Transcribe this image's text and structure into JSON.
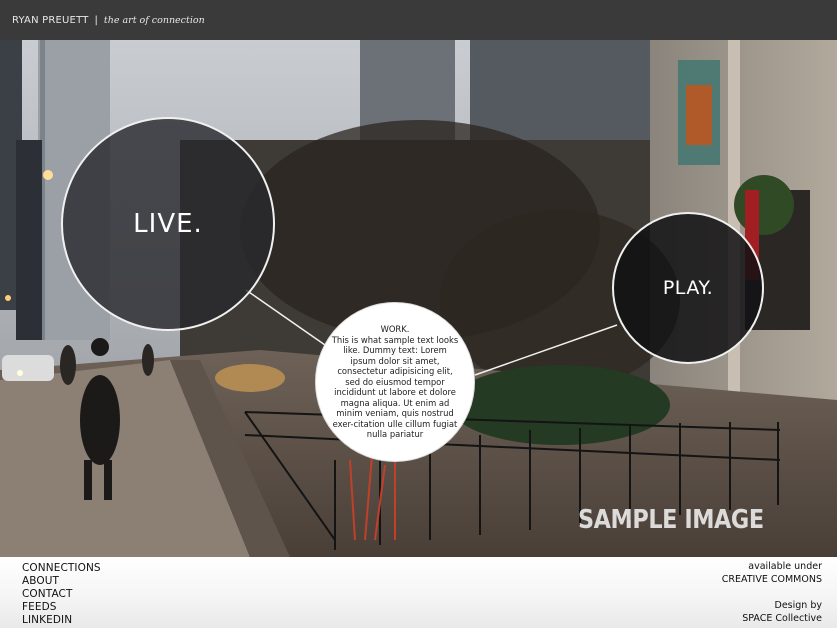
{
  "header": {
    "name": "RYAN PREUETT",
    "separator": "|",
    "tagline": "the art of connection"
  },
  "circles": {
    "live": "LIVE.",
    "play": "PLAY.",
    "work_title": "WORK.",
    "work_body": "This is what sample text looks like. Dummy text: Lorem ipsum dolor sit amet, consectetur adipisicing elit, sed do eiusmod tempor incididunt ut labore et dolore magna aliqua. Ut enim ad minim veniam, quis nostrud exer-citation ulle cillum fugiat nulla pariatur"
  },
  "watermark": "SAMPLE IMAGE",
  "nav": [
    "CONNECTIONS",
    "ABOUT",
    "CONTACT",
    "FEEDS",
    "LINKEDIN"
  ],
  "credits": {
    "line1": "available under",
    "line2": "CREATIVE COMMONS",
    "line3": "Design by",
    "line4": "SPACE Collective"
  },
  "colors": {
    "header_bg": "#3a3a3a",
    "circle_border": "#f0f0f0",
    "footer_bg": "#f4f4f4"
  }
}
